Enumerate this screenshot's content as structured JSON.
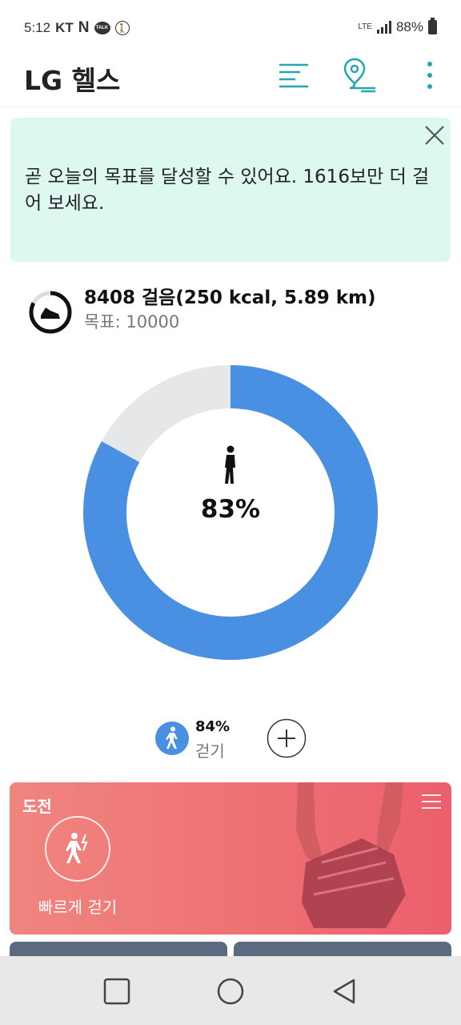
{
  "status_bar": {
    "time": "5:12",
    "carrier": "KT",
    "n_icon": "N",
    "talk_icon": "TALK",
    "network": "LTE",
    "battery": "88%"
  },
  "app_bar": {
    "title": "LG 헬스",
    "icons": [
      "list-icon",
      "map-pin-icon",
      "more-vert-icon"
    ],
    "accent_color": "#26a7b0"
  },
  "banner": {
    "message": "곧 오늘의 목표를 달성할 수 있어요. 1616보만 더 걸어 보세요.",
    "background": "#dcf8f1"
  },
  "summary": {
    "headline": "8408 걸음(250 kcal, 5.89 km)",
    "goal": "목표: 10000"
  },
  "progress": {
    "percent_label": "83%",
    "fraction": 0.83,
    "fill_color": "#4a90e2",
    "track_color": "#e5e7e8"
  },
  "activity": {
    "percent": "84%",
    "label": "걷기"
  },
  "challenge": {
    "title": "도전",
    "item_label": "빠르게 걷기"
  }
}
